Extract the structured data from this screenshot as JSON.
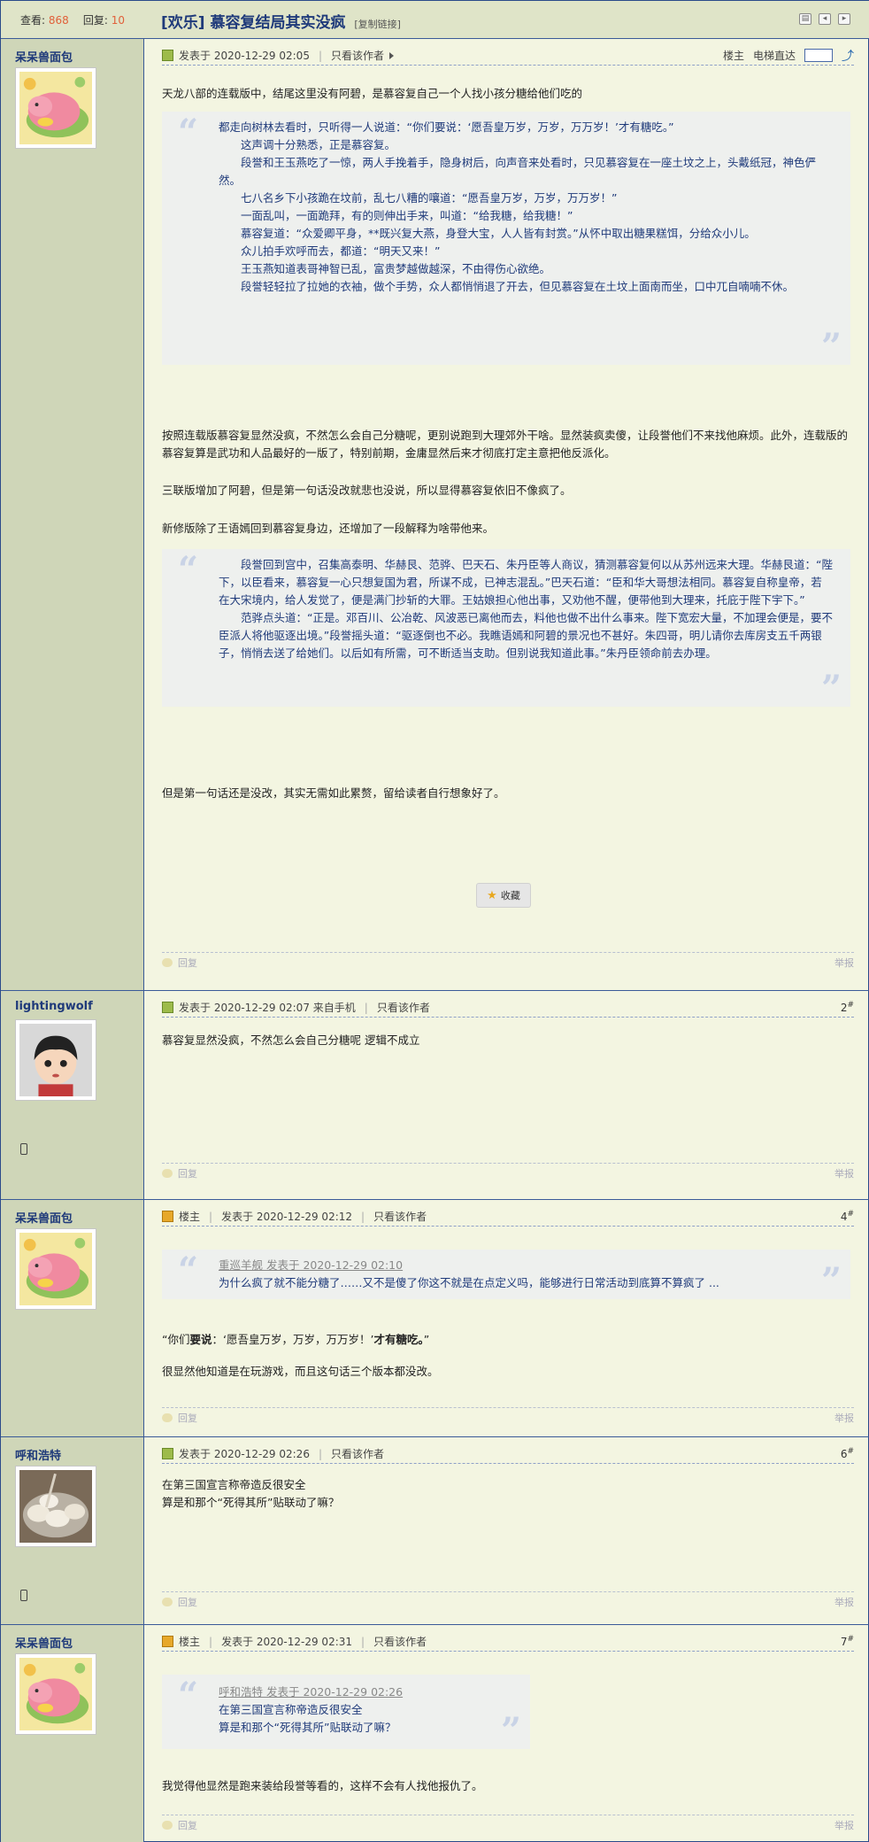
{
  "header": {
    "views_label": "查看:",
    "views": "868",
    "replies_label": "回复:",
    "replies": "10",
    "title": "[欢乐] 慕容复结局其实没疯",
    "copy_link": "[复制链接]"
  },
  "post1": {
    "author": "呆呆兽面包",
    "meta": "发表于 2020-12-29 02:05",
    "only_author": "只看该作者",
    "right1": "楼主",
    "right2": "电梯直达",
    "intro": "天龙八部的连载版中，结尾这里没有阿碧，是慕容复自己一个人找小孩分糖给他们吃的",
    "quote1": [
      "都走向树林去看时，只听得一人说道：“你们要说：‘愿吾皇万岁，万岁，万万岁！’才有糖吃。”",
      "　　这声调十分熟悉，正是慕容复。",
      "　　段誉和王玉燕吃了一惊，两人手挽着手，隐身树后，向声音来处看时，只见慕容复在一座土坟之上，头戴纸冠，神色俨然。",
      "　　七八名乡下小孩跪在坟前，乱七八糟的嚷道：“愿吾皇万岁，万岁，万万岁！”",
      "　　一面乱叫，一面跪拜，有的则伸出手来，叫道：“给我糖，给我糖！”",
      "　　慕容复道：“众爱卿平身，**既兴复大燕，身登大宝，人人皆有封赏。”从怀中取出糖果糕饵，分给众小儿。",
      "　　众儿拍手欢呼而去，都道：“明天又来！”",
      "　　王玉燕知道表哥神智已乱，富贵梦越做越深，不由得伤心欲绝。",
      "　　段誉轻轻拉了拉她的衣袖，做个手势，众人都悄悄退了开去，但见慕容复在土坟上面南而坐，口中兀自喃喃不休。"
    ],
    "para2": "按照连载版慕容复显然没疯，不然怎么会自己分糖呢，更别说跑到大理郊外干啥。显然装疯卖傻，让段誉他们不来找他麻烦。此外，连载版的慕容复算是武功和人品最好的一版了，特别前期，金庸显然后来才彻底打定主意把他反派化。",
    "para3": "三联版增加了阿碧，但是第一句话没改就悲也没说，所以显得慕容复依旧不像疯了。",
    "para4": "新修版除了王语嫣回到慕容复身边，还增加了一段解释为啥带他来。",
    "quote2": [
      "　　段誉回到宫中，召集高泰明、华赫艮、范骅、巴天石、朱丹臣等人商议，猜测慕容复何以从苏州远来大理。华赫艮道：“陛下，以臣看来，慕容复一心只想复国为君，所谋不成，已神志混乱。”巴天石道：“臣和华大哥想法相同。慕容复自称皇帝，若在大宋境内，给人发觉了，便是满门抄斩的大罪。王姑娘担心他出事，又劝他不醒，便带他到大理来，托庇于陛下宇下。”",
      "　　范骅点头道：“正是。邓百川、公冶乾、风波恶已离他而去，料他也做不出什么事来。陛下宽宏大量，不加理会便是，要不臣派人将他驱逐出境。”段誉摇头道：“驱逐倒也不必。我瞧语嫣和阿碧的景况也不甚好。朱四哥，明儿请你去库房支五千两银子，悄悄去送了给她们。以后如有所需，可不断适当支助。但别说我知道此事。”朱丹臣领命前去办理。"
    ],
    "para5": "但是第一句话还是没改，其实无需如此累赘，留给读者自行想象好了。",
    "fav": "收藏",
    "reply": "回复",
    "report": "举报"
  },
  "post2": {
    "author": "lightingwolf",
    "meta": "发表于 2020-12-29 02:07 来自手机",
    "only_author": "只看该作者",
    "floor": "2",
    "content": "慕容复显然没疯，不然怎么会自己分糖呢 逻辑不成立",
    "reply": "回复",
    "report": "举报"
  },
  "post3": {
    "author": "呆呆兽面包",
    "lz": "楼主",
    "meta": "发表于 2020-12-29 02:12",
    "only_author": "只看该作者",
    "floor": "4",
    "quote_head": "重巡羊舰 发表于 2020-12-29 02:10",
    "quote_body": "为什么疯了就不能分糖了……又不是傻了你这不就是在点定义吗，能够进行日常活动到底算不算疯了 ...",
    "line1a": "“你们",
    "line1b": "要说",
    "line1c": "：‘愿吾皇万岁，万岁，万万岁！’",
    "line1d": "才有糖吃。",
    "line1e": "”",
    "line2": "很显然他知道是在玩游戏，而且这句话三个版本都没改。",
    "reply": "回复",
    "report": "举报"
  },
  "post4": {
    "author": "呼和浩特",
    "meta": "发表于 2020-12-29 02:26",
    "only_author": "只看该作者",
    "floor": "6",
    "line1": "在第三国宣言称帝造反很安全",
    "line2": "算是和那个“死得其所”贴联动了嘛？",
    "reply": "回复",
    "report": "举报"
  },
  "post5": {
    "author": "呆呆兽面包",
    "lz": "楼主",
    "meta": "发表于 2020-12-29 02:31",
    "only_author": "只看该作者",
    "floor": "7",
    "quote_head": "呼和浩特 发表于 2020-12-29 02:26",
    "quote_l1": "在第三国宣言称帝造反很安全",
    "quote_l2": "算是和那个“死得其所”贴联动了嘛？",
    "content": "我觉得他显然是跑来装给段誉等看的，这样不会有人找他报仇了。",
    "reply": "回复",
    "report": "举报"
  }
}
